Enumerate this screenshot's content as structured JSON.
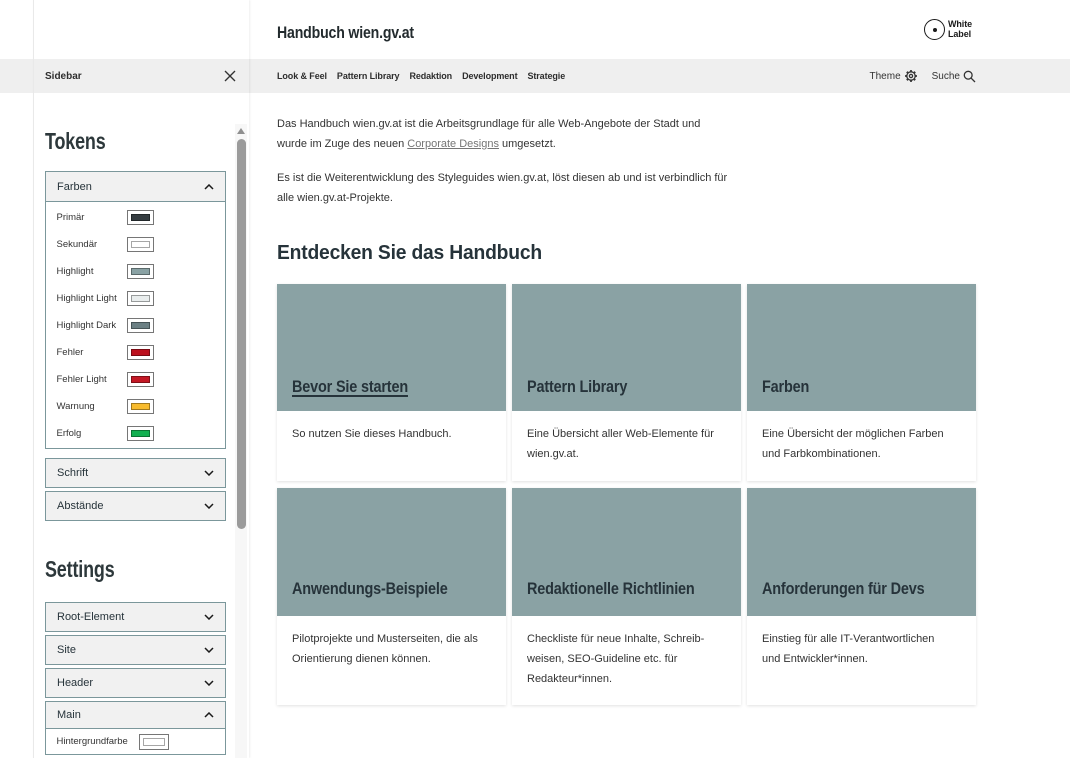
{
  "header": {
    "title": "Handbuch wien.gv.at",
    "logo": {
      "line1": "White",
      "line2": "Label"
    }
  },
  "nav": {
    "items": [
      {
        "label": "Look & Feel"
      },
      {
        "label": "Pattern Library"
      },
      {
        "label": "Redaktion"
      },
      {
        "label": "Development"
      },
      {
        "label": "Strategie"
      }
    ],
    "actions": {
      "theme_label": "Theme",
      "search_label": "Suche"
    }
  },
  "sidebar": {
    "title": "Sidebar",
    "tokens_heading": "Tokens",
    "settings_heading": "Settings",
    "farben": {
      "label": "Farben",
      "expanded": true,
      "rows": [
        {
          "label": "Primär",
          "color": "#343c40"
        },
        {
          "label": "Sekundär",
          "color": "#ffffff"
        },
        {
          "label": "Highlight",
          "color": "#8aa2a4"
        },
        {
          "label": "Highlight Light",
          "color": "#e9eded"
        },
        {
          "label": "Highlight Dark",
          "color": "#6b8084"
        },
        {
          "label": "Fehler",
          "color": "#bc101e"
        },
        {
          "label": "Fehler Light",
          "color": "#c31825"
        },
        {
          "label": "Warnung",
          "color": "#f8bb2d"
        },
        {
          "label": "Erfolg",
          "color": "#12b151"
        }
      ]
    },
    "schrift": {
      "label": "Schrift",
      "expanded": false
    },
    "abstaende": {
      "label": "Abstände",
      "expanded": false
    },
    "root_element": {
      "label": "Root-Element",
      "expanded": false
    },
    "site": {
      "label": "Site",
      "expanded": false
    },
    "header_acc": {
      "label": "Header",
      "expanded": false
    },
    "main_acc": {
      "label": "Main",
      "expanded": true,
      "rows": [
        {
          "label": "Hintergrundfarbe",
          "color": "#ffffff"
        }
      ]
    }
  },
  "main": {
    "intro": {
      "p1_before_link": "Das Handbuch wien.gv.at ist die Arbeitsgrundlage für alle Web-Angebote der Stadt und wurde im Zuge des neuen ",
      "p1_link": "Corporate Designs",
      "p1_after_link": " umgesetzt.",
      "p2": "Es ist die Weiterentwicklung des Styleguides wien.gv.at, löst diesen ab und ist verbindlich für alle wien.gv.at-Projekte."
    },
    "heading": "Entdecken Sie das Handbuch",
    "card_image_color": "#8aa2a4",
    "cards": [
      {
        "title": "Bevor Sie starten",
        "description": "So nutzen Sie dieses Handbuch.",
        "title_underlined": true
      },
      {
        "title": "Pattern Library",
        "description": "Eine Übersicht aller Web-Elemente für wien.gv.at.",
        "title_underlined": false
      },
      {
        "title": "Farben",
        "description": "Eine Übersicht der möglichen Farben und Farbkombinationen.",
        "title_underlined": false
      },
      {
        "title": "Anwendungs-Beispiele",
        "description": "Pilotprojekte und Musterseiten, die als Orientierung dienen können.",
        "title_underlined": false
      },
      {
        "title": "Redaktionelle Richtlinien",
        "description": "Checkliste für neue Inhalte, Schreib-weisen, SEO-Guideline etc. für Redakteur*innen.",
        "title_underlined": false
      },
      {
        "title": "Anforderungen für Devs",
        "description": "Einstieg für alle IT-Verantwortlichen und Entwickler*innen.",
        "title_underlined": false
      }
    ]
  },
  "colors": {
    "accent_teal": "#8aa2a4",
    "band_gray": "#efefef",
    "accordion_border": "#7b979b",
    "heading_text": "#2d383b",
    "body_text": "#333333"
  }
}
